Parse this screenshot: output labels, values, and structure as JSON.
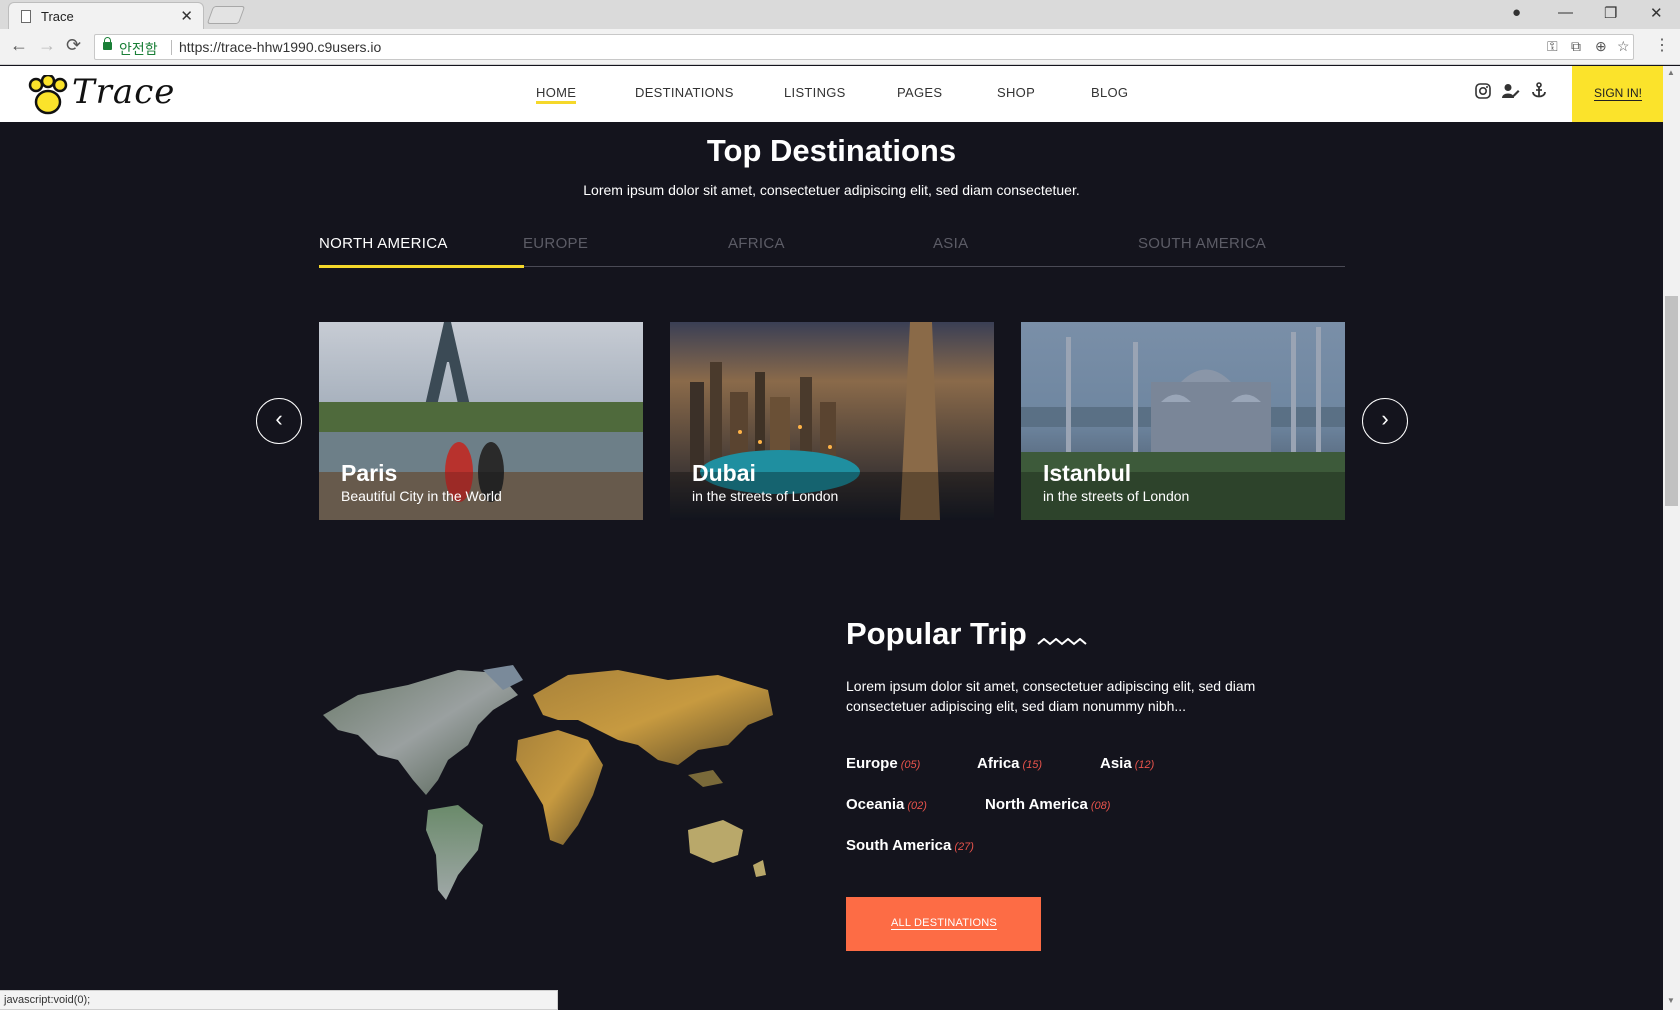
{
  "browser": {
    "tab_title": "Trace",
    "tab_close": "✕",
    "secure_label": "안전함",
    "url": "https://trace-hhw1990.c9users.io",
    "window_controls": [
      "—",
      "❐",
      "✕"
    ],
    "nav": [
      "←",
      "→",
      "⟳"
    ],
    "status_text": "javascript:void(0);"
  },
  "site": {
    "logo_text": "Trace",
    "menu": [
      "HOME",
      "DESTINATIONS",
      "LISTINGS",
      "PAGES",
      "SHOP",
      "BLOG"
    ],
    "active_menu": "HOME",
    "header_icons": [
      "instagram-icon",
      "user-edit-icon",
      "anchor-icon"
    ],
    "sign_in": "SIGN IN!",
    "accent_color": "#f5d82a",
    "cta_color": "#fd6c45"
  },
  "top_destinations": {
    "title": "Top Destinations",
    "subtitle": "Lorem ipsum dolor sit amet, consectetuer adipiscing elit, sed diam consectetuer.",
    "tabs": [
      "NORTH AMERICA",
      "EUROPE",
      "AFRICA",
      "ASIA",
      "SOUTH AMERICA"
    ],
    "active_tab": "NORTH AMERICA",
    "cards": [
      {
        "title": "Paris",
        "subtitle": "Beautiful City in the World"
      },
      {
        "title": "Dubai",
        "subtitle": "in the streets of London"
      },
      {
        "title": "Istanbul",
        "subtitle": "in the streets of London"
      }
    ],
    "prev": "‹",
    "next": "›"
  },
  "popular_trip": {
    "title": "Popular Trip",
    "description": "Lorem ipsum dolor sit amet, consectetuer adipiscing elit, sed diam consectetuer adipiscing elit, sed diam nonummy nibh...",
    "continents": [
      {
        "name": "Europe",
        "count": "(05)"
      },
      {
        "name": "Africa",
        "count": "(15)"
      },
      {
        "name": "Asia",
        "count": "(12)"
      },
      {
        "name": "Oceania",
        "count": "(02)"
      },
      {
        "name": "North America",
        "count": "(08)"
      },
      {
        "name": "South America",
        "count": "(27)"
      }
    ],
    "button": "ALL DESTINATIONS"
  }
}
